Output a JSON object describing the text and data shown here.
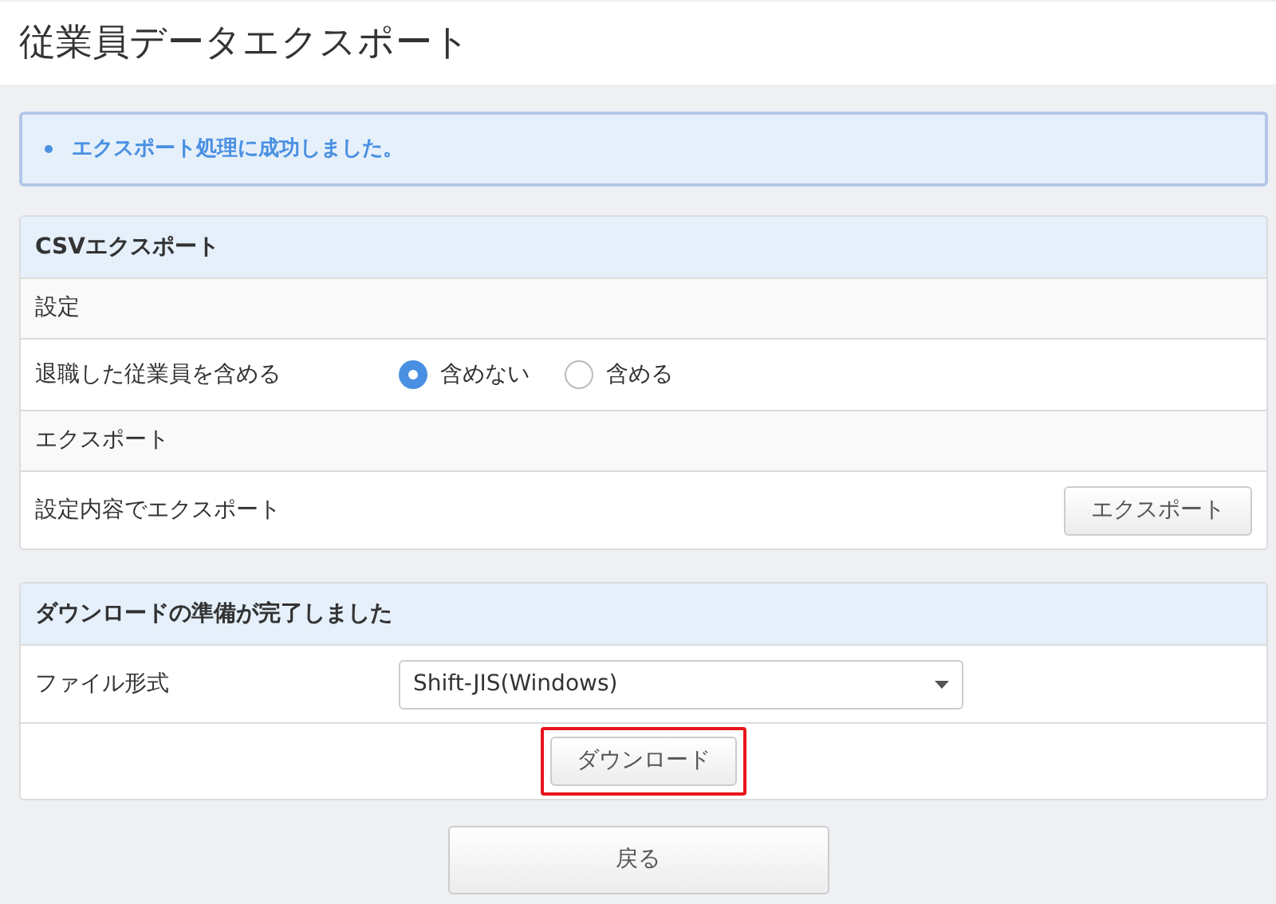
{
  "title": "従業員データエクスポート",
  "alert": {
    "message": "エクスポート処理に成功しました。"
  },
  "csv_panel": {
    "title": "CSVエクスポート",
    "rows": [
      {
        "kind": "section",
        "label": "設定"
      },
      {
        "kind": "radio",
        "label": "退職した従業員を含める",
        "options": [
          {
            "label": "含めない",
            "selected": true
          },
          {
            "label": "含める",
            "selected": false
          }
        ]
      },
      {
        "kind": "section",
        "label": "エクスポート"
      },
      {
        "kind": "button",
        "label": "設定内容でエクスポート",
        "button": "エクスポート"
      }
    ]
  },
  "download_panel": {
    "title": "ダウンロードの準備が完了しました",
    "file_format": {
      "label": "ファイル形式",
      "value": "Shift-JIS(Windows)"
    },
    "download_button": {
      "label": "ダウンロード",
      "highlighted": true
    }
  },
  "back_button": "戻る"
}
